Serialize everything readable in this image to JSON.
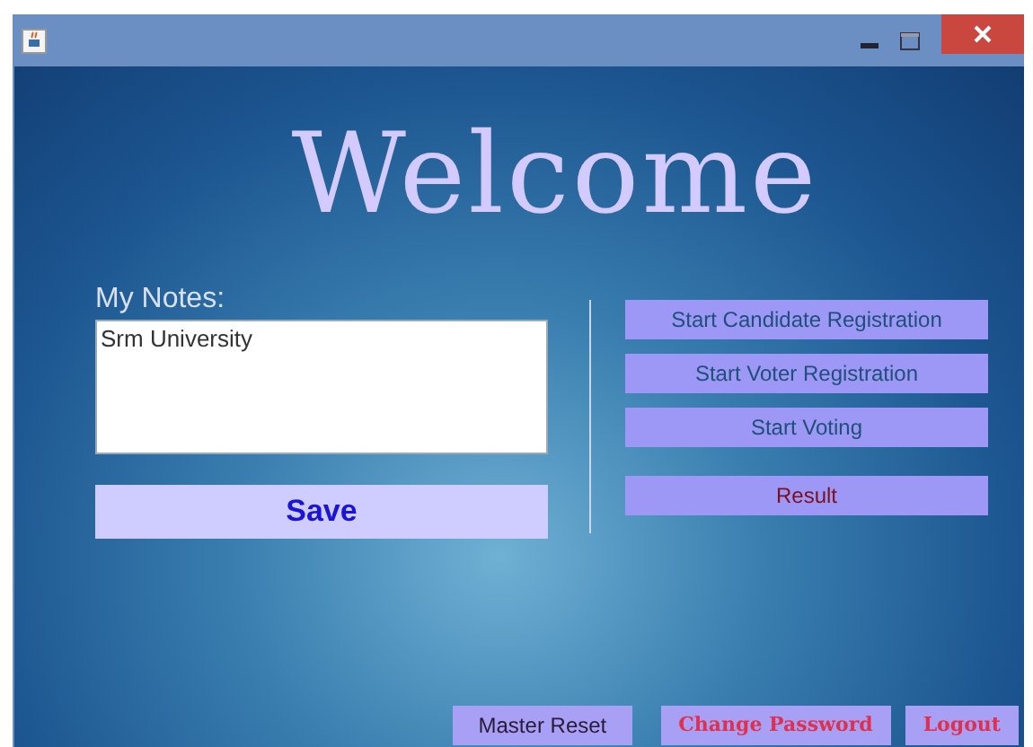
{
  "heading": "Welcome",
  "notes": {
    "label": "My Notes:",
    "value": "Srm University"
  },
  "save_button": "Save",
  "actions": [
    {
      "label": "Start Candidate Registration",
      "kind": "start"
    },
    {
      "label": "Start Voter Registration",
      "kind": "start"
    },
    {
      "label": "Start Voting",
      "kind": "start"
    },
    {
      "label": "Result",
      "kind": "result"
    }
  ],
  "footer_buttons": [
    {
      "label": "Master Reset",
      "kind": "plain"
    },
    {
      "label": "Change Password",
      "kind": "alert"
    },
    {
      "label": "Logout",
      "kind": "alert"
    }
  ]
}
